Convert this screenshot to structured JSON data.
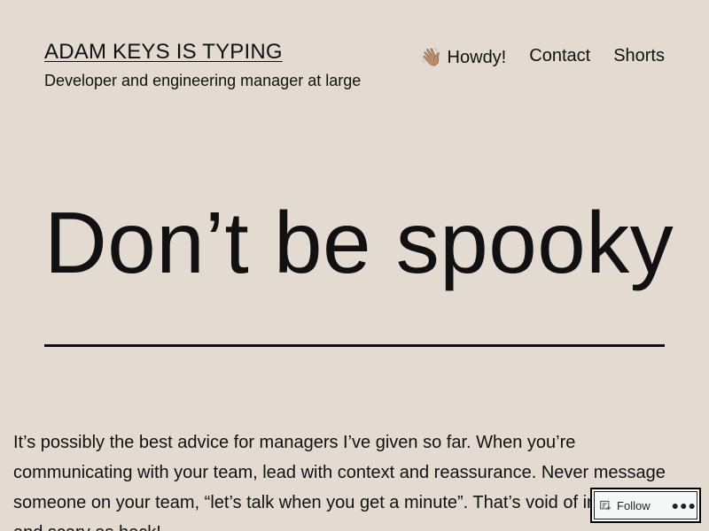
{
  "site": {
    "title": "ADAM KEYS IS TYPING",
    "tagline": "Developer and engineering manager at large"
  },
  "nav": {
    "items": [
      {
        "label": "👋🏽 Howdy!"
      },
      {
        "label": "Contact"
      },
      {
        "label": "Shorts"
      }
    ]
  },
  "post": {
    "title": "Don’t be spooky",
    "body": "It’s possibly the best advice for managers I’ve given so far. When you’re communicating with your team, lead with context and reassurance. Never message someone on your team, “let’s talk when you get a minute”. That’s void of information and scary as heck!"
  },
  "follow_widget": {
    "label": "Follow",
    "more_icon": "more-horizontal-icon",
    "icon": "reader-follow-icon"
  },
  "colors": {
    "background": "#e3dad2",
    "text": "#111111",
    "widget_bg": "#ffffff"
  }
}
